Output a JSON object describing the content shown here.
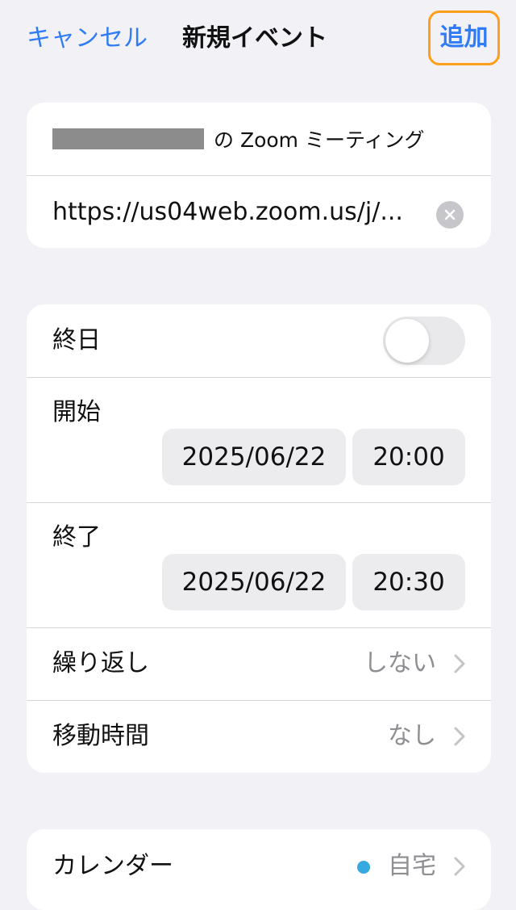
{
  "nav": {
    "cancel": "キャンセル",
    "title": "新規イベント",
    "add": "追加"
  },
  "event": {
    "title_suffix": "の Zoom ミーティング",
    "url": "https://us04web.zoom.us/j/..."
  },
  "schedule": {
    "all_day_label": "終日",
    "all_day_on": false,
    "start_label": "開始",
    "start_date": "2025/06/22",
    "start_time": "20:00",
    "end_label": "終了",
    "end_date": "2025/06/22",
    "end_time": "20:30",
    "repeat_label": "繰り返し",
    "repeat_value": "しない",
    "travel_label": "移動時間",
    "travel_value": "なし"
  },
  "calendar": {
    "label": "カレンダー",
    "value": "自宅",
    "color": "#35a9e0"
  },
  "colors": {
    "accent": "#2f7cf6",
    "highlight": "#ff9e1b",
    "background": "#f2f1f6"
  }
}
